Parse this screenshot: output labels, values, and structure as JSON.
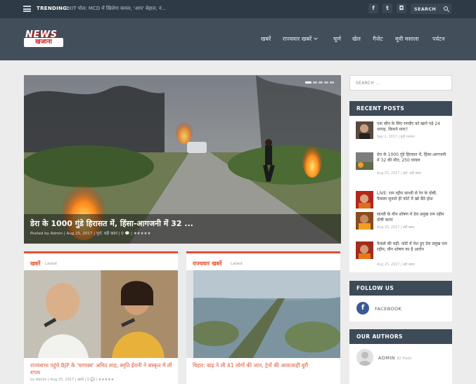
{
  "topbar": {
    "trending_label": "TRENDING:",
    "trending_text": "EXIT पोल: MCD में खिलेगा कमल, 'आप' बेहाल, नं...",
    "social": [
      "f",
      "t",
      "ig"
    ],
    "search_placeholder": "SEARCH"
  },
  "header": {
    "logo_top": "NEWS",
    "logo_bottom": "खजाना",
    "nav": [
      {
        "label": "खबरें"
      },
      {
        "label": "राज्यवार खबरें"
      },
      {
        "label": "चूर्ण"
      },
      {
        "label": "खेल"
      },
      {
        "label": "गैजेट"
      },
      {
        "label": "मूवी मसाला"
      },
      {
        "label": "पर्यटन"
      }
    ]
  },
  "slider": {
    "title": "डेरा के 1000 गुंडे हिरासत में, हिंसा-आगजनी में 32 ...",
    "meta": "Posted by Admin | Aug 25, 2017 | चूर्ण, बड़ी खबर | 0 💬 | ★★★★★"
  },
  "cards": [
    {
      "tag": "खबरें",
      "sub": "Latest",
      "title": "राज्यसभा पहुंचे BJP के 'चाणक्य' अमित शाह, स्मृति ईरानी ने संस्कृत में ली शपथ",
      "meta": "by Admin | Aug 25, 2017 | खबरें | 0 💬 | ★★★★★"
    },
    {
      "tag": "राज्यवार खबरें",
      "sub": "Latest",
      "title": "बिहार: बाढ़ ने ली 41 लोगों की जान, ट्रेनों की आवाजाही बुरी",
      "meta": ""
    }
  ],
  "sidebar": {
    "search_placeholder": "SEARCH ...",
    "recent_title": "RECENT POSTS",
    "posts": [
      {
        "title": "एक सीन के लिए रणवीर को खाने पड़े 24 थप्पड़, किसने मारा?",
        "meta": "Sep 2, 2017 | मूवी मसाला"
      },
      {
        "title": "डेरा के 1000 गुंडे हिरासत में, हिंसा-आगजनी में 32 की मौत, 250 घायल",
        "meta": "Aug 25, 2017 | चूर्ण, बड़ी खबर"
      },
      {
        "title": "LIVE: राम रहीम साध्वी से रेप के दोषी, फैसला सुनाते ही कोर्ट में खो बैठे होश",
        "meta": ""
      },
      {
        "title": "साध्वी के यौन शोषण में डेरा प्रमुख राम रहीम दोषी करार",
        "meta": "Aug 25, 2017 | बड़ी खबर"
      },
      {
        "title": "फैसले की घड़ी: कोर्ट में पेश हुए डेरा प्रमुख राम रहीम, यौन शोषण का है आरोप",
        "meta": "Aug 25, 2017 | बड़ी खबर"
      }
    ],
    "follow_title": "FOLLOW US",
    "facebook_label": "FACEBOOK",
    "authors_title": "OUR AUTHORS",
    "author_name": "ADMIN",
    "author_posts": "82 Posts"
  }
}
